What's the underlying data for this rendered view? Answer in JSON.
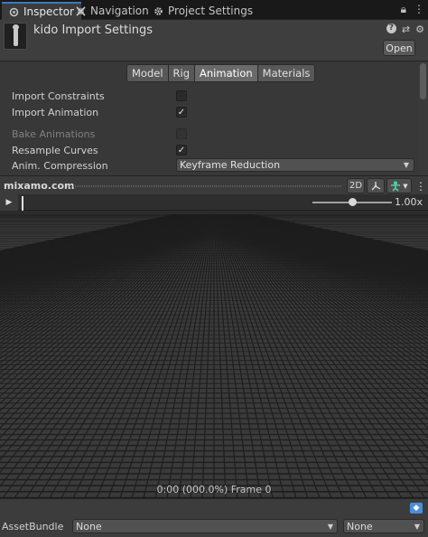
{
  "tabs": [
    {
      "label": "Inspector",
      "icon": "inspector-icon",
      "active": true
    },
    {
      "label": "Navigation",
      "icon": "navigation-icon",
      "active": false
    },
    {
      "label": "Project Settings",
      "icon": "gear-icon",
      "active": false
    }
  ],
  "header": {
    "title": "kido Import Settings",
    "open_label": "Open"
  },
  "import_tabs": [
    "Model",
    "Rig",
    "Animation",
    "Materials"
  ],
  "active_import_tab": "Animation",
  "properties": {
    "import_constraints": {
      "label": "Import Constraints",
      "checked": false
    },
    "import_animation": {
      "label": "Import Animation",
      "checked": true
    },
    "bake_animations": {
      "label": "Bake Animations",
      "checked": false,
      "disabled": true
    },
    "resample_curves": {
      "label": "Resample Curves",
      "checked": true
    },
    "anim_compression": {
      "label": "Anim. Compression",
      "value": "Keyframe Reduction"
    }
  },
  "preview": {
    "name": "mixamo.com",
    "mode_2d": "2D",
    "speed_label": "1.00x",
    "speed": 1.0,
    "frame_label": "0:00 (000.0%) Frame 0"
  },
  "asset_bundle": {
    "label": "AssetBundle",
    "name_value": "None",
    "variant_value": "None"
  },
  "colors": {
    "accent": "#3a79bb",
    "panel": "#383838",
    "button": "#585858"
  }
}
